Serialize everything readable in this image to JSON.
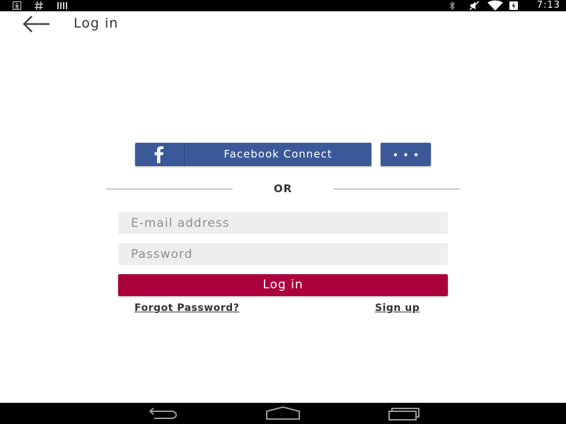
{
  "status_bar": {
    "time": "7:13",
    "left_icons": [
      "download-icon",
      "hash-icon",
      "bars-icon"
    ],
    "right_icons": [
      "bluetooth-icon",
      "mute-icon",
      "wifi-icon",
      "battery-charging-icon"
    ]
  },
  "app_bar": {
    "title": "Log in",
    "back_icon": "back-arrow-icon"
  },
  "social": {
    "facebook_label": "Facebook Connect",
    "facebook_icon": "facebook-icon",
    "more_icon": "more-dots-icon"
  },
  "divider": {
    "label": "OR"
  },
  "form": {
    "email": {
      "placeholder": "E-mail address",
      "value": ""
    },
    "password": {
      "placeholder": "Password",
      "value": ""
    },
    "login_label": "Log in",
    "forgot_label": "Forgot Password?",
    "signup_label": "Sign up"
  },
  "nav_bar": {
    "buttons": [
      "nav-back-icon",
      "nav-home-icon",
      "nav-recents-icon"
    ]
  },
  "colors": {
    "facebook_blue": "#3b5998",
    "login_crimson": "#ab003c",
    "field_bg": "#eeeeee",
    "system_bars": "#000000"
  }
}
